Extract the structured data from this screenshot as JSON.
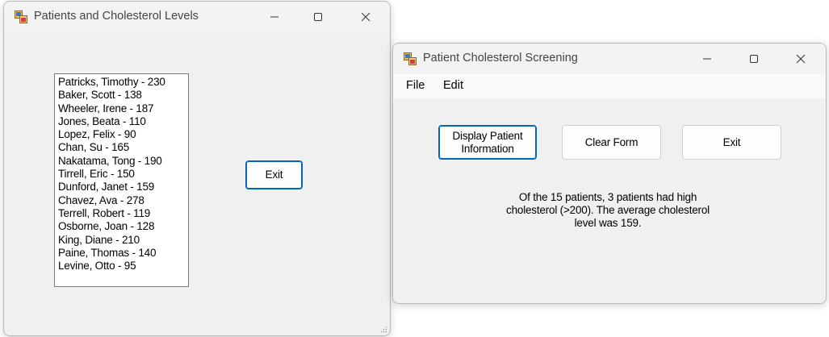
{
  "window1": {
    "title": "Patients and Cholesterol Levels",
    "patients": [
      "Patricks, Timothy - 230",
      "Baker, Scott - 138",
      "Wheeler, Irene - 187",
      "Jones, Beata - 110",
      "Lopez, Felix - 90",
      "Chan, Su - 165",
      "Nakatama, Tong - 190",
      "Tirrell, Eric - 150",
      "Dunford, Janet - 159",
      "Chavez, Ava - 278",
      "Terrell, Robert - 119",
      "Osborne, Joan - 128",
      "King, Diane - 210",
      "Paine, Thomas - 140",
      "Levine, Otto - 95"
    ],
    "exit_label": "Exit"
  },
  "window2": {
    "title": "Patient Cholesterol Screening",
    "menu": {
      "file": "File",
      "edit": "Edit"
    },
    "display_label": "Display Patient Information",
    "clear_label": "Clear Form",
    "exit_label": "Exit",
    "summary": "Of the 15 patients, 3 patients had high cholesterol (>200). The average cholesterol level was 159."
  },
  "colors": {
    "focus_border": "#0067c0",
    "window_bg": "#f0f0f0"
  },
  "icons": [
    "app-icon",
    "minimize-icon",
    "maximize-icon",
    "close-icon"
  ]
}
